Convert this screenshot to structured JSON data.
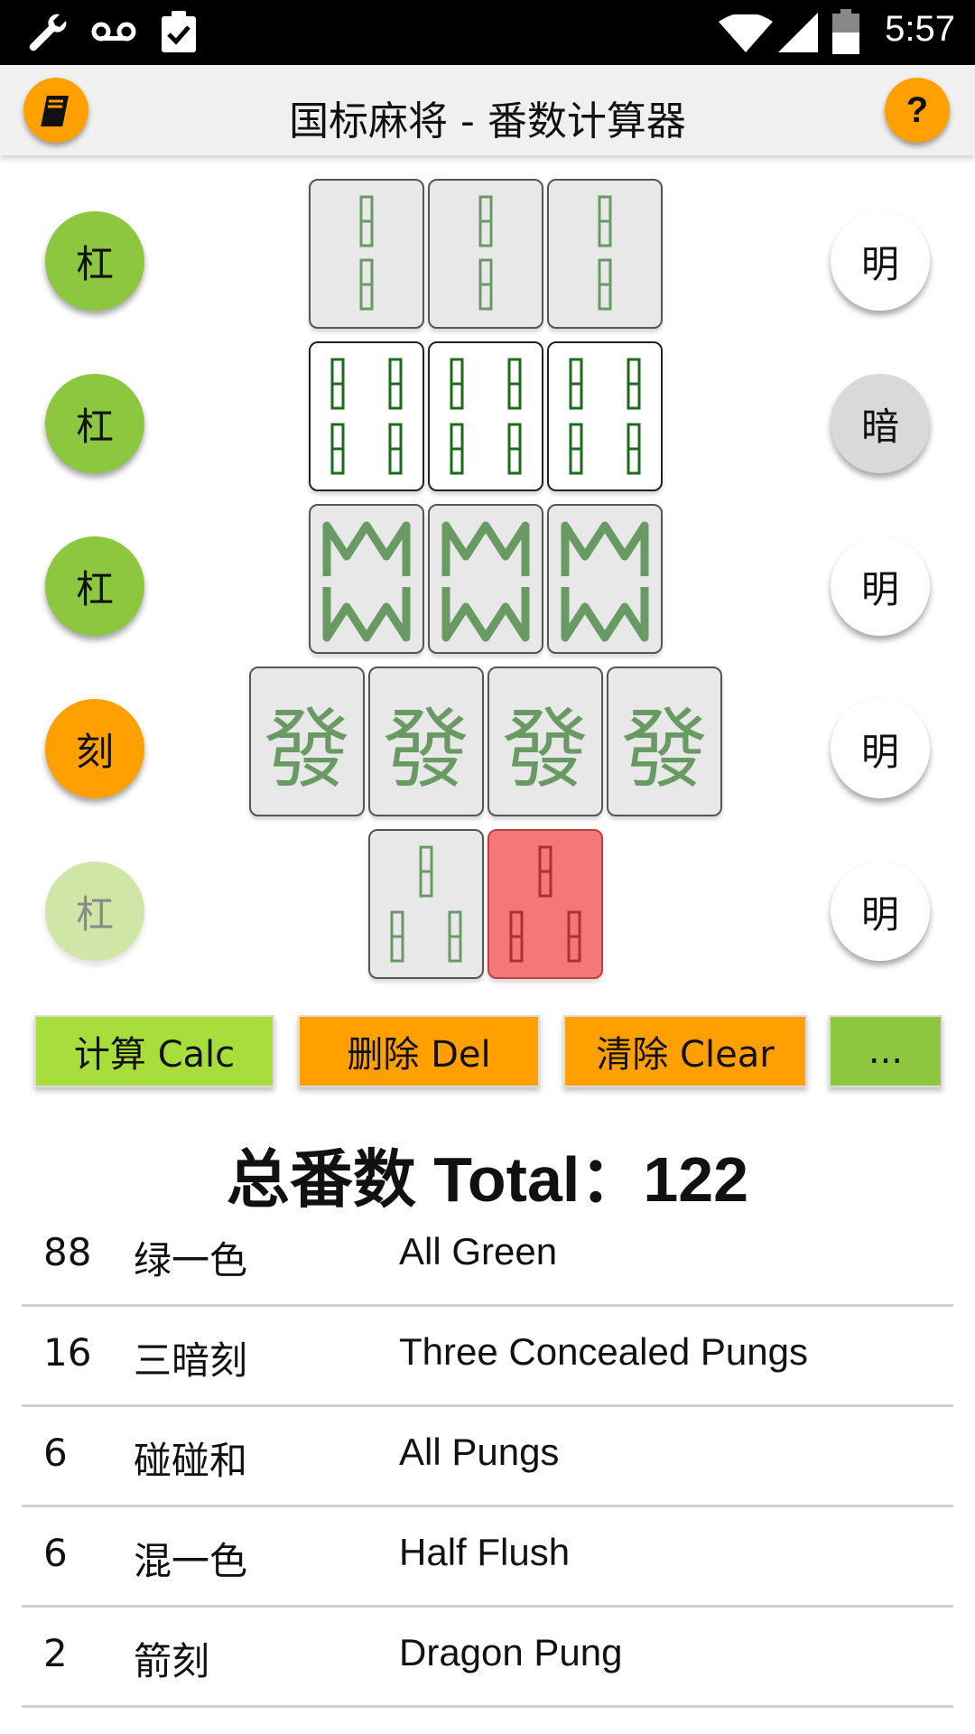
{
  "status_bar": {
    "time": "5:57",
    "icons": [
      "wrench-icon",
      "voicemail-icon",
      "clipboard-check-icon",
      "wifi-icon",
      "signal-icon",
      "battery-icon"
    ]
  },
  "app_bar": {
    "title": "国标麻将 - 番数计算器",
    "left_icon": "book-icon",
    "help_label": "?"
  },
  "tile_rows": [
    {
      "left": "杠",
      "left_state": "green",
      "right": "明",
      "right_state": "white",
      "tiles": [
        {
          "suit": "bamboo",
          "rank": 2,
          "state": "grey"
        },
        {
          "suit": "bamboo",
          "rank": 2,
          "state": "grey"
        },
        {
          "suit": "bamboo",
          "rank": 2,
          "state": "grey"
        }
      ]
    },
    {
      "left": "杠",
      "left_state": "green",
      "right": "暗",
      "right_state": "grey",
      "tiles": [
        {
          "suit": "bamboo",
          "rank": 4,
          "state": "active"
        },
        {
          "suit": "bamboo",
          "rank": 4,
          "state": "active"
        },
        {
          "suit": "bamboo",
          "rank": 4,
          "state": "active"
        }
      ]
    },
    {
      "left": "杠",
      "left_state": "green",
      "right": "明",
      "right_state": "white",
      "tiles": [
        {
          "suit": "bamboo",
          "rank": 8,
          "state": "grey"
        },
        {
          "suit": "bamboo",
          "rank": 8,
          "state": "grey"
        },
        {
          "suit": "bamboo",
          "rank": 8,
          "state": "grey"
        }
      ]
    },
    {
      "left": "刻",
      "left_state": "orange",
      "right": "明",
      "right_state": "white",
      "tiles": [
        {
          "suit": "dragon",
          "char": "發",
          "state": "grey"
        },
        {
          "suit": "dragon",
          "char": "發",
          "state": "grey"
        },
        {
          "suit": "dragon",
          "char": "發",
          "state": "grey"
        },
        {
          "suit": "dragon",
          "char": "發",
          "state": "grey"
        }
      ]
    },
    {
      "left": "杠",
      "left_state": "faded",
      "right": "明",
      "right_state": "white",
      "tiles": [
        {
          "suit": "bamboo",
          "rank": 3,
          "state": "grey"
        },
        {
          "suit": "bamboo",
          "rank": 3,
          "state": "red"
        }
      ]
    }
  ],
  "buttons": {
    "calc": "计算 Calc",
    "del": "删除 Del",
    "clear": "清除 Clear",
    "more": "..."
  },
  "total": "总番数 Total：122",
  "results": [
    {
      "fan": "88",
      "cn": "绿一色",
      "en": "All Green"
    },
    {
      "fan": "16",
      "cn": "三暗刻",
      "en": "Three Concealed Pungs"
    },
    {
      "fan": "6",
      "cn": "碰碰和",
      "en": "All Pungs"
    },
    {
      "fan": "6",
      "cn": "混一色",
      "en": "Half Flush"
    },
    {
      "fan": "2",
      "cn": "箭刻",
      "en": "Dragon Pung"
    }
  ],
  "colors": {
    "accent_orange": "#ffa000",
    "accent_green": "#8dc63f",
    "calc_green": "#a8de3c",
    "selected_tile": "#f47878",
    "tile_bamboo": "#6a9a64",
    "tile_bamboo_active": "#1d6b1d"
  }
}
